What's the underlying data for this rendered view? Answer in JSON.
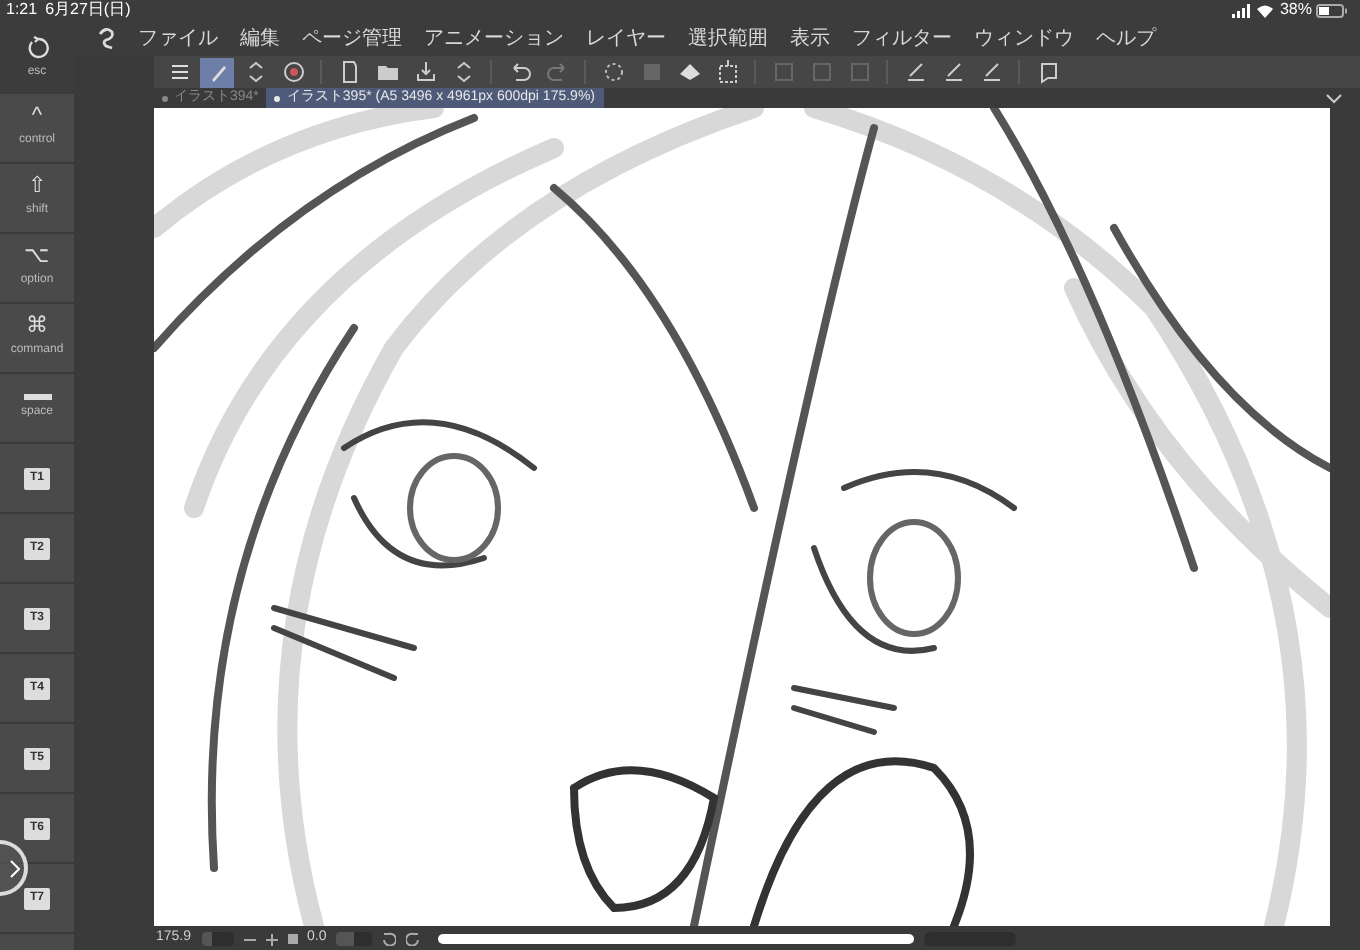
{
  "status_bar": {
    "time": "1:21",
    "date": "6月27日(日)",
    "battery": "38%"
  },
  "menu": [
    "ファイル",
    "編集",
    "ページ管理",
    "アニメーション",
    "レイヤー",
    "選択範囲",
    "表示",
    "フィルター",
    "ウィンドウ",
    "ヘルプ"
  ],
  "modifier_keys": [
    {
      "kind": "icon",
      "label": "esc"
    },
    {
      "kind": "glyph",
      "glyph": "^",
      "label": "control"
    },
    {
      "kind": "glyph",
      "glyph": "⇧",
      "label": "shift"
    },
    {
      "kind": "glyph",
      "glyph": "⌥",
      "label": "option"
    },
    {
      "kind": "glyph",
      "glyph": "⌘",
      "label": "command"
    },
    {
      "kind": "bar",
      "label": "space"
    },
    {
      "kind": "key",
      "label": "T1"
    },
    {
      "kind": "key",
      "label": "T2"
    },
    {
      "kind": "key",
      "label": "T3"
    },
    {
      "kind": "key",
      "label": "T4"
    },
    {
      "kind": "key",
      "label": "T5"
    },
    {
      "kind": "key",
      "label": "T6"
    },
    {
      "kind": "key",
      "label": "T7"
    }
  ],
  "toolbar": [
    {
      "kind": "menu",
      "selected": false
    },
    {
      "kind": "pen",
      "selected": true
    },
    {
      "kind": "updown",
      "selected": false
    },
    {
      "kind": "eye",
      "selected": false
    },
    {
      "kind": "sep"
    },
    {
      "kind": "doc",
      "selected": false
    },
    {
      "kind": "folder",
      "selected": false
    },
    {
      "kind": "save",
      "selected": false
    },
    {
      "kind": "updown",
      "selected": false
    },
    {
      "kind": "sep"
    },
    {
      "kind": "undo",
      "selected": false
    },
    {
      "kind": "redo",
      "selected": false
    },
    {
      "kind": "sep"
    },
    {
      "kind": "spark",
      "selected": false
    },
    {
      "kind": "layer",
      "selected": false
    },
    {
      "kind": "fill",
      "selected": false
    },
    {
      "kind": "crop",
      "selected": false
    },
    {
      "kind": "sep"
    },
    {
      "kind": "square",
      "selected": false
    },
    {
      "kind": "square",
      "selected": false
    },
    {
      "kind": "square",
      "selected": false
    },
    {
      "kind": "sep"
    },
    {
      "kind": "brush",
      "selected": false
    },
    {
      "kind": "brush",
      "selected": false
    },
    {
      "kind": "brush",
      "selected": false
    },
    {
      "kind": "sep"
    },
    {
      "kind": "help",
      "selected": false
    }
  ],
  "tabs": [
    {
      "label": "イラスト394*",
      "selected": false
    },
    {
      "label": "イラスト395* (A5 3496 x 4961px 600dpi 175.9%)",
      "selected": true
    }
  ],
  "bottom_bar": {
    "zoom": "175.9",
    "zoom_slider": {
      "level": 0.35
    },
    "angle": "0.0",
    "angle_slider": {
      "level": 0.5
    }
  }
}
